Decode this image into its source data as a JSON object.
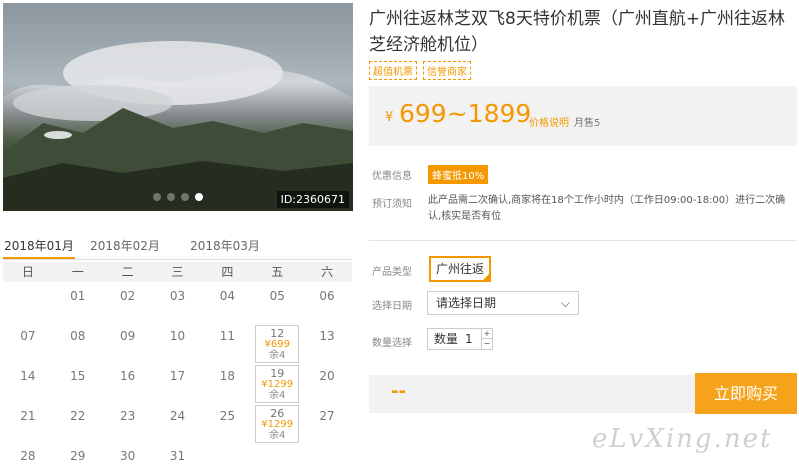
{
  "photo": {
    "id_label": "ID:2360671",
    "slide_count": 4,
    "active_slide": 4
  },
  "calendar": {
    "months": [
      "2018年01月",
      "2018年02月",
      "2018年03月"
    ],
    "active_month": 0,
    "weekdays": [
      "日",
      "一",
      "二",
      "三",
      "四",
      "五",
      "六"
    ],
    "weeks": [
      [
        {
          "day": ""
        },
        {
          "day": "01"
        },
        {
          "day": "02"
        },
        {
          "day": "03"
        },
        {
          "day": "04"
        },
        {
          "day": "05"
        },
        {
          "day": "06"
        }
      ],
      [
        {
          "day": "07"
        },
        {
          "day": "08"
        },
        {
          "day": "09"
        },
        {
          "day": "10"
        },
        {
          "day": "11"
        },
        {
          "day": "12",
          "price": "¥699",
          "stock": "余4"
        },
        {
          "day": "13"
        }
      ],
      [
        {
          "day": "14"
        },
        {
          "day": "15"
        },
        {
          "day": "16"
        },
        {
          "day": "17"
        },
        {
          "day": "18"
        },
        {
          "day": "19",
          "price": "¥1299",
          "stock": "余4"
        },
        {
          "day": "20"
        }
      ],
      [
        {
          "day": "21"
        },
        {
          "day": "22"
        },
        {
          "day": "23"
        },
        {
          "day": "24"
        },
        {
          "day": "25"
        },
        {
          "day": "26",
          "price": "¥1299",
          "stock": "余4"
        },
        {
          "day": "27"
        }
      ],
      [
        {
          "day": "28"
        },
        {
          "day": "29"
        },
        {
          "day": "30"
        },
        {
          "day": "31"
        },
        {
          "day": ""
        },
        {
          "day": ""
        },
        {
          "day": ""
        }
      ]
    ]
  },
  "product": {
    "title": "广州往返林芝双飞8天特价机票（广州直航+广州往返林芝经济舱机位）",
    "tags": [
      "超值机票",
      "信誉商家"
    ],
    "price_yen": "¥",
    "price_range": "699~1899",
    "price_note": "价格说明",
    "monthly_sales": "月售5",
    "promo_label": "优惠信息",
    "promo_badge": "蜂蜜抵10%",
    "notice_label": "预订须知",
    "notice_text": "此产品需二次确认,商家将在18个工作小时内（工作日09:00-18:00）进行二次确认,核实是否有位",
    "type_label": "产品类型",
    "type_option": "广州往返",
    "date_label": "选择日期",
    "date_placeholder": "请选择日期",
    "qty_label": "数量选择",
    "qty_prefix": "数量",
    "qty_value": "1",
    "total": "--",
    "buy_label": "立即购买"
  },
  "watermark": "eLvXing.net",
  "colors": {
    "accent": "#f39800",
    "buy_button": "#f5a31a",
    "panel_bg": "#f2f2f2"
  }
}
